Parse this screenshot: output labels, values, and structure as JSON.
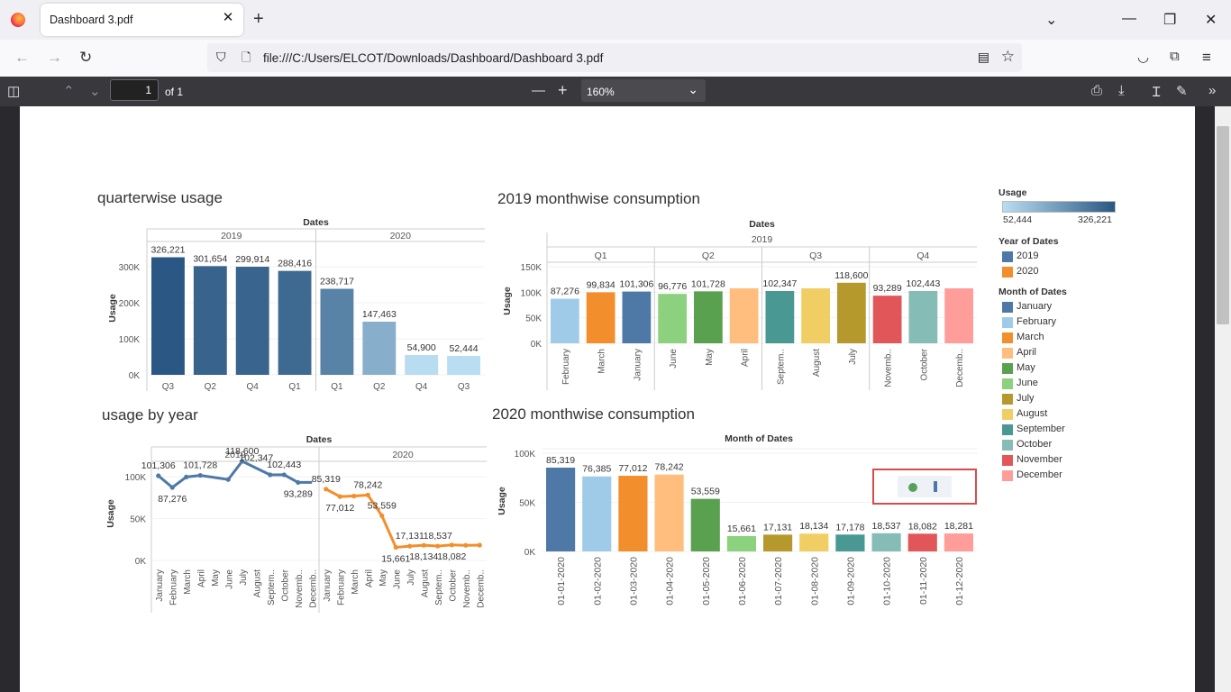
{
  "browser": {
    "tab_title": "Dashboard 3.pdf",
    "tab_close": "✕",
    "new_tab": "+",
    "url": "file:///C:/Users/ELCOT/Downloads/Dashboard/Dashboard 3.pdf"
  },
  "pdf_toolbar": {
    "page_number": "1",
    "of_pages": "of 1",
    "zoom": "160%"
  },
  "dashboard": {
    "quarter_title": "quarterwise usage",
    "m2019_title": "2019 monthwise consumption",
    "year_title": "usage by year",
    "m2020_title": "2020 monthwise consumption"
  },
  "colors": {
    "January": "#4e79a7",
    "February": "#a0cbe8",
    "March": "#f28e2b",
    "April": "#ffbe7d",
    "May": "#59a14f",
    "June": "#8cd17d",
    "July": "#b6992d",
    "August": "#f1ce63",
    "September": "#499894",
    "October": "#86bcb6",
    "November": "#e15759",
    "December": "#ff9d9a",
    "y2019": "#4e79a7",
    "y2020": "#f28e2b"
  },
  "legend": {
    "usage_title": "Usage",
    "usage_min": "52,444",
    "usage_max": "326,221",
    "year_title": "Year of Dates",
    "years": [
      "2019",
      "2020"
    ],
    "month_title": "Month of Dates",
    "months": [
      "January",
      "February",
      "March",
      "April",
      "May",
      "June",
      "July",
      "August",
      "September",
      "October",
      "November",
      "December"
    ]
  },
  "chart_data": [
    {
      "type": "bar",
      "title": "quarterwise usage",
      "header": "Dates",
      "ylabel": "Usage",
      "ylim": [
        0,
        330000
      ],
      "yticks": [
        "0K",
        "100K",
        "200K",
        "300K"
      ],
      "panes": [
        {
          "name": "2019",
          "categories": [
            "Q3",
            "Q2",
            "Q4",
            "Q1"
          ],
          "values": [
            326221,
            301654,
            299914,
            288416
          ],
          "labels": [
            "326,221",
            "301,654",
            "299,914",
            "288,416"
          ]
        },
        {
          "name": "2020",
          "categories": [
            "Q1",
            "Q2",
            "Q4",
            "Q3"
          ],
          "values": [
            238717,
            147463,
            54900,
            52444
          ],
          "labels": [
            "238,717",
            "147,463",
            "54,900",
            "52,444"
          ]
        }
      ]
    },
    {
      "type": "bar",
      "title": "2019 monthwise consumption",
      "header": "Dates",
      "year": "2019",
      "ylabel": "Usage",
      "ylim": [
        0,
        150000
      ],
      "yticks": [
        "0K",
        "50K",
        "100K",
        "150K"
      ],
      "quarters": [
        {
          "name": "Q1",
          "categories": [
            "February",
            "March",
            "January"
          ],
          "values": [
            87276,
            99834,
            101306
          ],
          "labels": [
            "87,276",
            "99,834",
            "101,306"
          ]
        },
        {
          "name": "Q2",
          "categories": [
            "June",
            "May",
            "April"
          ],
          "values": [
            96776,
            101728,
            null
          ],
          "labels": [
            "96,776",
            "101,728",
            ""
          ]
        },
        {
          "name": "Q3",
          "categories": [
            "Septem..",
            "August",
            "July"
          ],
          "values": [
            102347,
            null,
            118600
          ],
          "labels": [
            "102,347",
            "",
            "118,600"
          ]
        },
        {
          "name": "Q4",
          "categories": [
            "Novemb..",
            "October",
            "Decemb.."
          ],
          "values": [
            93289,
            102443,
            null
          ],
          "labels": [
            "93,289",
            "102,443",
            ""
          ]
        }
      ]
    },
    {
      "type": "line",
      "title": "usage by year",
      "header": "Dates",
      "ylabel": "Usage",
      "ylim": [
        0,
        125000
      ],
      "yticks": [
        "0K",
        "50K",
        "100K"
      ],
      "categories": [
        "January",
        "February",
        "March",
        "April",
        "May",
        "June",
        "July",
        "August",
        "Septem..",
        "October",
        "Novemb..",
        "Decemb.."
      ],
      "series": [
        {
          "name": "2019",
          "values": [
            101306,
            87276,
            99834,
            101728,
            null,
            96776,
            118600,
            null,
            102347,
            102443,
            93289,
            null
          ],
          "labels": [
            "101,306",
            "87,276",
            "",
            "101,728",
            "",
            "",
            "118,600",
            "102,347",
            "",
            "102,443",
            "93,289",
            ""
          ]
        },
        {
          "name": "2020",
          "values": [
            85319,
            76385,
            77012,
            78242,
            53559,
            15661,
            17131,
            18134,
            17178,
            18537,
            18082,
            18281
          ],
          "labels": [
            "85,319",
            "77,012",
            "",
            "78,242",
            "53,559",
            "15,661",
            "17,131",
            "18,134",
            "18,537",
            "18,082",
            "",
            ""
          ]
        }
      ]
    },
    {
      "type": "bar",
      "title": "2020 monthwise consumption",
      "header": "Month of Dates",
      "ylabel": "Usage",
      "ylim": [
        0,
        100000
      ],
      "yticks": [
        "0K",
        "50K",
        "100K"
      ],
      "categories": [
        "01-01-2020",
        "01-02-2020",
        "01-03-2020",
        "01-04-2020",
        "01-05-2020",
        "01-06-2020",
        "01-07-2020",
        "01-08-2020",
        "01-09-2020",
        "01-10-2020",
        "01-11-2020",
        "01-12-2020"
      ],
      "values": [
        85319,
        76385,
        77012,
        78242,
        53559,
        15661,
        17131,
        18134,
        17178,
        18537,
        18082,
        18281
      ],
      "labels": [
        "85,319",
        "76,385",
        "77,012",
        "78,242",
        "53,559",
        "15,661",
        "17,131",
        "18,134",
        "17,178",
        "18,537",
        "18,082",
        "18,281"
      ]
    }
  ]
}
